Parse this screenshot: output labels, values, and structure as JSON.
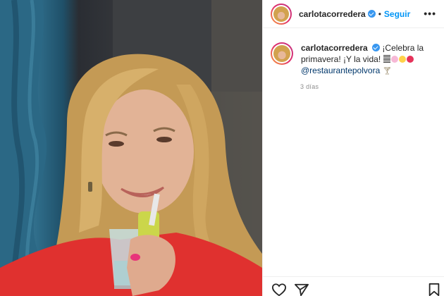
{
  "post": {
    "username": "carlotacorredera",
    "separator": "•",
    "follow_label": "Seguir",
    "more_label": "•••",
    "caption_username": "carlotacorredera",
    "caption_text_line1": "¡Celebra la",
    "caption_text_line2": "primavera! ¡Y la vida!",
    "mention": "@restaurantepolvora",
    "time_ago": "3 días"
  },
  "colors": {
    "accent": "#0095f6",
    "verified": "#3897f0",
    "mention": "#00376b",
    "muted": "#8e8e8e"
  },
  "icons": {
    "verified": "verified-badge-icon",
    "like": "heart-icon",
    "share": "paper-plane-icon",
    "save": "bookmark-icon",
    "more": "more-options-icon"
  }
}
